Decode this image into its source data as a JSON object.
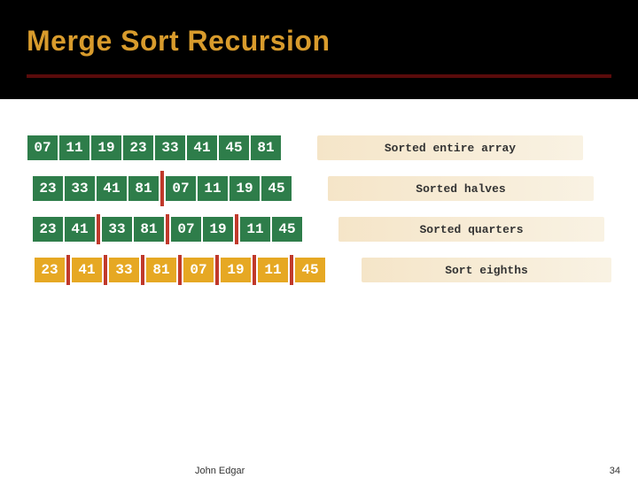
{
  "title": "Merge Sort Recursion",
  "rows": [
    {
      "cells": [
        "07",
        "11",
        "19",
        "23",
        "33",
        "41",
        "45",
        "81"
      ],
      "label": "Sorted entire array"
    },
    {
      "cells": [
        "23",
        "33",
        "41",
        "81",
        "07",
        "11",
        "19",
        "45"
      ],
      "label": "Sorted halves"
    },
    {
      "cells": [
        "23",
        "41",
        "33",
        "81",
        "07",
        "19",
        "11",
        "45"
      ],
      "label": "Sorted quarters"
    },
    {
      "cells": [
        "23",
        "41",
        "33",
        "81",
        "07",
        "19",
        "11",
        "45"
      ],
      "label": "Sort eighths"
    }
  ],
  "footer": {
    "author": "John Edgar",
    "page": "34"
  }
}
